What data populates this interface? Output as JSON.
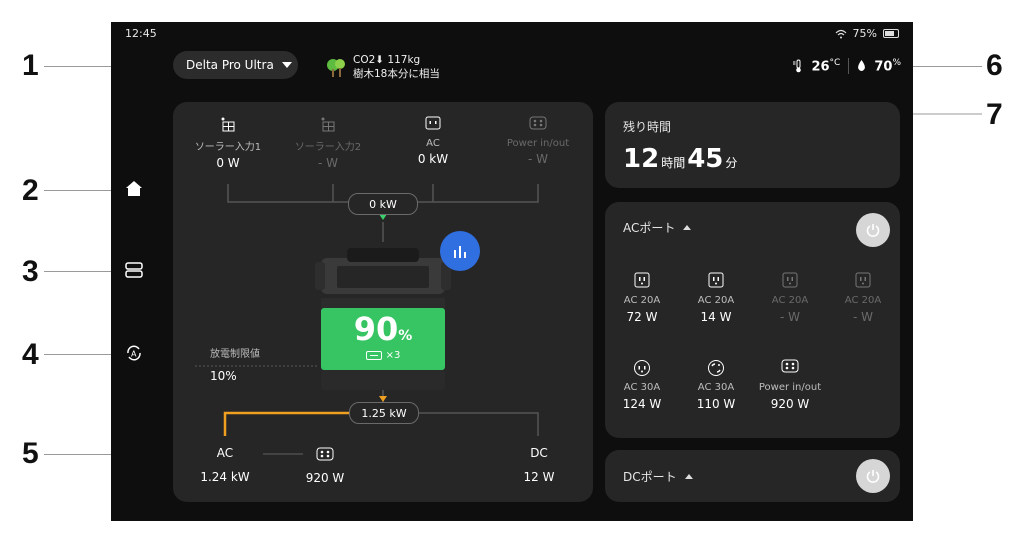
{
  "callouts": [
    "1",
    "2",
    "3",
    "4",
    "5",
    "6",
    "7"
  ],
  "status": {
    "time": "12:45",
    "battery": "75%"
  },
  "header": {
    "device": "Delta Pro Ultra",
    "co2_line1": "CO2⬇ 117kg",
    "co2_line2": "樹木18本分に相当",
    "temperature": "26",
    "temp_unit": "°C",
    "humidity": "70",
    "humidity_unit": "%"
  },
  "inputs": [
    {
      "label": "ソーラー入力1",
      "value": "0 W"
    },
    {
      "label": "ソーラー入力2",
      "value": "- W"
    },
    {
      "label": "AC",
      "value": "0 kW"
    },
    {
      "label": "Power in/out",
      "value": "- W"
    }
  ],
  "flow": {
    "input_total": "0 kW",
    "output_total": "1.25 kW"
  },
  "battery": {
    "percent": "90",
    "percent_unit": "%",
    "packs": "×3",
    "level": 0.9
  },
  "discharge": {
    "label": "放電制限値",
    "value": "10%"
  },
  "outputs": {
    "ac_label": "AC",
    "ac_value": "1.24 kW",
    "pio_value": "920 W",
    "dc_label": "DC",
    "dc_value": "12 W"
  },
  "remaining": {
    "title": "残り時間",
    "hours": "12",
    "hours_unit": "時間",
    "minutes": "45",
    "minutes_unit": "分"
  },
  "ac_ports": {
    "title": "ACポート",
    "ports": [
      {
        "label": "AC 20A",
        "value": "72 W"
      },
      {
        "label": "AC 20A",
        "value": "14 W"
      },
      {
        "label": "AC 20A",
        "value": "- W"
      },
      {
        "label": "AC 20A",
        "value": "- W"
      },
      {
        "label": "AC 30A",
        "value": "124 W"
      },
      {
        "label": "AC 30A",
        "value": "110 W"
      },
      {
        "label": "Power in/out",
        "value": "920 W"
      }
    ]
  },
  "dc_ports": {
    "title": "DCポート"
  },
  "colors": {
    "accent_blue": "#2f6fe0",
    "battery_green": "#37c462",
    "flow_orange": "#f0a020",
    "flow_green": "#3bd06b"
  }
}
